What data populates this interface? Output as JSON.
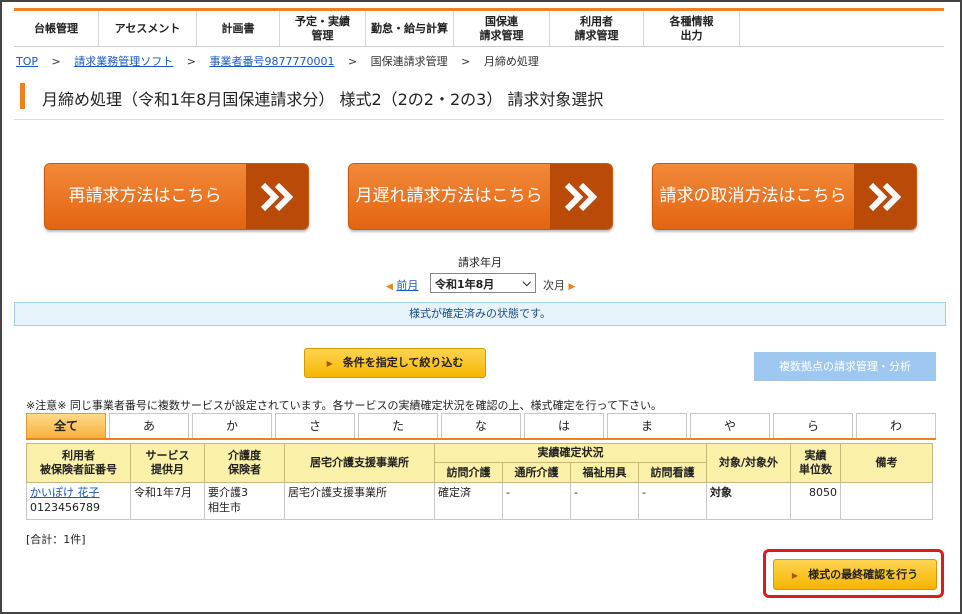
{
  "nav": [
    "台帳管理",
    "アセスメント",
    "計画書",
    "予定・実績\n管理",
    "勤怠・給与計算",
    "国保連\n請求管理",
    "利用者\n請求管理",
    "各種情報\n出力"
  ],
  "breadcrumb": {
    "top": "TOP",
    "item1": "請求業務管理ソフト",
    "item2": "事業者番号9877770001",
    "item3": "国保連請求管理",
    "item4": "月締め処理",
    "sep": ">"
  },
  "page_title": "月締め処理（令和1年8月国保連請求分） 様式2（2の2・2の3） 請求対象選択",
  "big_buttons": {
    "rebill": "再請求方法はこちら",
    "late": "月遅れ請求方法はこちら",
    "cancel": "請求の取消方法はこちら"
  },
  "month": {
    "label": "請求年月",
    "prev": "前月",
    "selected": "令和1年8月",
    "next": "次月"
  },
  "status_message": "様式が確定済みの状態です。",
  "filter_button": "条件を指定して絞り込む",
  "multi_button": "複数拠点の請求管理・分析",
  "notice": "※注意※ 同じ事業者番号に複数サービスが設定されています。各サービスの実績確定状況を確認の上、様式確定を行って下さい。",
  "tabs": [
    "全て",
    "あ",
    "か",
    "さ",
    "た",
    "な",
    "は",
    "ま",
    "や",
    "ら",
    "わ"
  ],
  "table": {
    "headers": {
      "user": "利用者\n被保険者証番号",
      "service_month": "サービス\n提供月",
      "care_level": "介護度\n保険者",
      "office": "居宅介護支援事業所",
      "status_group": "実績確定状況",
      "visit_care": "訪問介護",
      "day_care": "通所介護",
      "welfare": "福祉用具",
      "visit_nursing": "訪問看護",
      "target": "対象/対象外",
      "units": "実績\n単位数",
      "remarks": "備考"
    },
    "rows": [
      {
        "user_name": "かいぽけ 花子",
        "insured_no": "0123456789",
        "service_month": "令和1年7月",
        "care_level": "要介護3",
        "insurer": "相生市",
        "office": "居宅介護支援事業所",
        "visit_care": "確定済",
        "day_care": "-",
        "welfare": "-",
        "visit_nursing": "-",
        "target": "対象",
        "units": "8050",
        "remarks": ""
      }
    ]
  },
  "total": "[合計：1件]",
  "final_button": "様式の最終確認を行う"
}
